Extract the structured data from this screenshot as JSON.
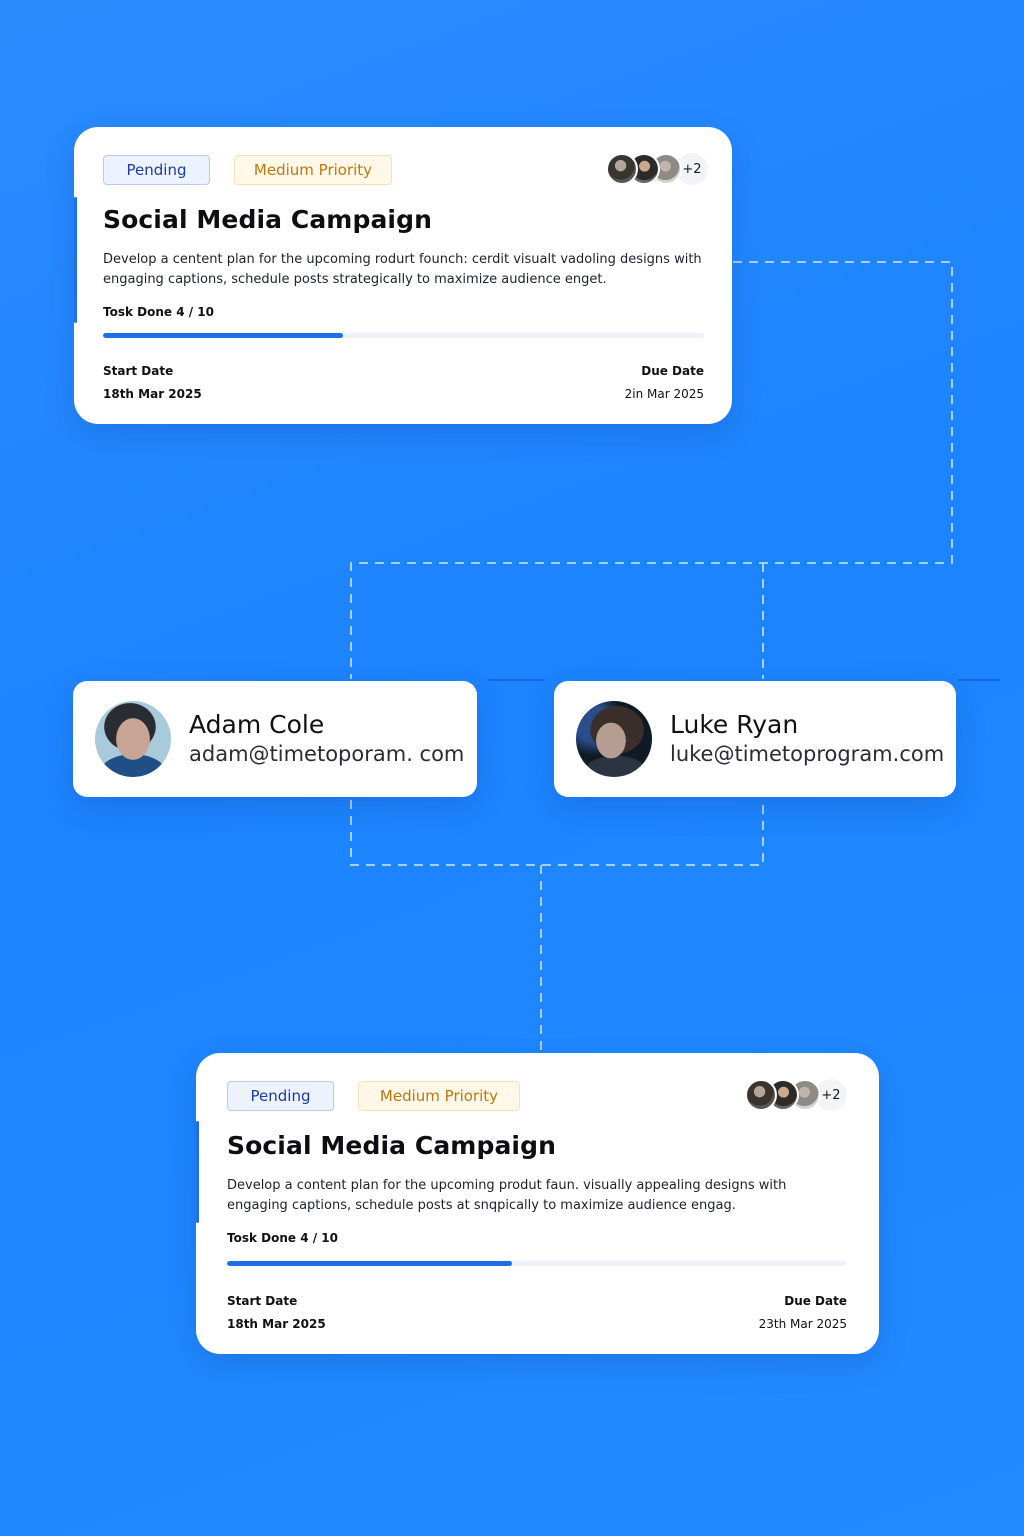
{
  "colors": {
    "background": "#1f86ff",
    "card": "#ffffff",
    "accent": "#1d6fe8",
    "pending_bg": "#edf2ff",
    "pending_text": "#1d3aa8",
    "priority_bg": "#fff8e8",
    "priority_text": "#c2770a"
  },
  "task_cards": [
    {
      "status_label": "Pending",
      "priority_label": "Medium Priority",
      "member_icons": [
        "member-avatar",
        "member-avatar",
        "member-avatar"
      ],
      "extra_members_label": "+2",
      "title": "Social Media Campaign",
      "description": "Develop a centent plan for the upcoming rodurt founch: cerdit visualt vadoling designs with engaging captions, schedule posts strategically to maximize audience enget.",
      "progress_label": "Tosk Done 4 / 10",
      "progress": 0.4,
      "start_label": "Start Date",
      "start_value": "18th Mar 2025",
      "due_label": "Due Date",
      "due_value": "2in Mar 2025"
    },
    {
      "status_label": "Pending",
      "priority_label": "Medium Priority",
      "member_icons": [
        "member-avatar",
        "member-avatar",
        "member-avatar"
      ],
      "extra_members_label": "+2",
      "title": "Social Media Campaign",
      "description": "Develop a content plan for the upcoming produt faun. visually appealing designs with engaging captions, schedule posts at snqpically to maximize audience engag.",
      "progress_label": "Tosk Done 4 / 10",
      "progress": 0.46,
      "start_label": "Start Date",
      "start_value": "18th Mar 2025",
      "due_label": "Due Date",
      "due_value": "23th Mar 2025"
    }
  ],
  "people": [
    {
      "name": "Adam Cole",
      "email": "adam@timetoporam. com",
      "avatar_icon": "person-avatar"
    },
    {
      "name": "Luke Ryan",
      "email": "luke@timetoprogram.com",
      "avatar_icon": "person-avatar"
    }
  ]
}
